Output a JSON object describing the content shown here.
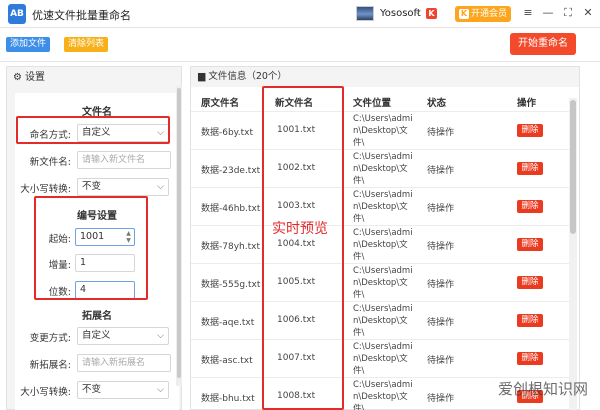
{
  "app": {
    "logo_text": "AB",
    "title": "优速文件批量重命名"
  },
  "user": {
    "name": "Yososoft",
    "caret": "⌵",
    "badge": "K"
  },
  "vip": {
    "label": "开通会员",
    "badge": "K"
  },
  "window_controls": {
    "menu": "≡",
    "minimize": "—",
    "maximize": "⛶",
    "close": "✕"
  },
  "toolbar": {
    "add": "添加文件",
    "clear": "清除列表",
    "start": "开始重命名"
  },
  "settings": {
    "header": "设置",
    "filename_section": {
      "title": "文件名",
      "naming_mode_label": "命名方式:",
      "naming_mode_value": "自定义",
      "new_name_label": "新文件名:",
      "new_name_placeholder": "请输入新文件名",
      "case_label": "大小写转换:",
      "case_value": "不变"
    },
    "numbering_section": {
      "title": "编号设置",
      "start_label": "起始:",
      "start_value": "1001",
      "step_label": "增量:",
      "step_value": "1",
      "digits_label": "位数:",
      "digits_value": "4"
    },
    "extension_section": {
      "title": "拓展名",
      "change_label": "变更方式:",
      "change_value": "自定义",
      "new_ext_label": "新拓展名:",
      "new_ext_placeholder": "请输入新拓展名",
      "case_label": "大小写转换:",
      "case_value": "不变"
    }
  },
  "file_list": {
    "header": "文件信息（20个）",
    "columns": [
      "原文件名",
      "新文件名",
      "文件位置",
      "状态",
      "操作"
    ],
    "rows": [
      {
        "orig": "数据-6by.txt",
        "new": "1001.txt",
        "loc": "C:\\Users\\admin\\Desktop\\文件\\",
        "status": "待操作",
        "action": "删除"
      },
      {
        "orig": "数据-23de.txt",
        "new": "1002.txt",
        "loc": "C:\\Users\\admin\\Desktop\\文件\\",
        "status": "待操作",
        "action": "删除"
      },
      {
        "orig": "数据-46hb.txt",
        "new": "1003.txt",
        "loc": "C:\\Users\\admin\\Desktop\\文件\\",
        "status": "待操作",
        "action": "删除"
      },
      {
        "orig": "数据-78yh.txt",
        "new": "1004.txt",
        "loc": "C:\\Users\\admin\\Desktop\\文件\\",
        "status": "待操作",
        "action": "删除"
      },
      {
        "orig": "数据-555g.txt",
        "new": "1005.txt",
        "loc": "C:\\Users\\admin\\Desktop\\文件\\",
        "status": "待操作",
        "action": "删除"
      },
      {
        "orig": "数据-aqe.txt",
        "new": "1006.txt",
        "loc": "C:\\Users\\admin\\Desktop\\文件\\",
        "status": "待操作",
        "action": "删除"
      },
      {
        "orig": "数据-asc.txt",
        "new": "1007.txt",
        "loc": "C:\\Users\\admin\\Desktop\\文件\\",
        "status": "待操作",
        "action": "删除"
      },
      {
        "orig": "数据-bhu.txt",
        "new": "1008.txt",
        "loc": "C:\\Users\\admin\\Desktop\\文件\\",
        "status": "待操作",
        "action": "删除"
      }
    ],
    "preview_annotation": "实时预览"
  },
  "watermark": "爱创根知识网",
  "colors": {
    "accent_red": "#e52a2a",
    "add_blue": "#3d8ee6",
    "clear_orange": "#f7b018",
    "start_red": "#f24a2a",
    "vip_orange": "#fda51c"
  }
}
